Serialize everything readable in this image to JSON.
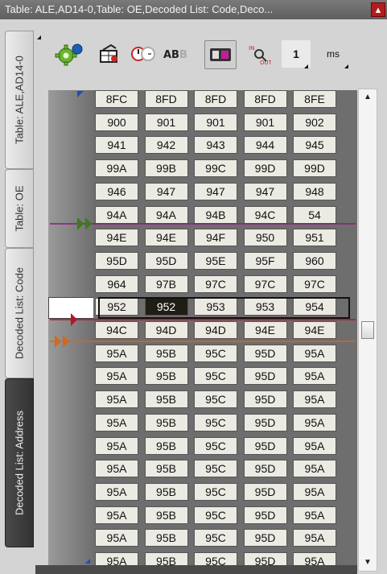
{
  "window": {
    "title": "Table: ALE,AD14-0,Table: OE,Decoded List: Code,Deco..."
  },
  "tabs": [
    {
      "label": "Table: ALE,AD14-0"
    },
    {
      "label": "Table: OE"
    },
    {
      "label": "Decoded List: Code"
    },
    {
      "label": "Decoded List: Address"
    }
  ],
  "toolbar": {
    "items": [
      {
        "name": "settings-gear-icon"
      },
      {
        "name": "clear-table-icon"
      },
      {
        "name": "time-compare-icon"
      },
      {
        "name": "ab-text-icon"
      },
      {
        "name": "toggle-display-icon"
      },
      {
        "name": "in-out-probe-icon"
      }
    ],
    "step_value": "1",
    "step_unit": "ms"
  },
  "grid": {
    "rows": [
      [
        "8FC",
        "8FD",
        "8FD",
        "8FD",
        "8FE"
      ],
      [
        "900",
        "901",
        "901",
        "901",
        "902"
      ],
      [
        "941",
        "942",
        "943",
        "944",
        "945"
      ],
      [
        "99A",
        "99B",
        "99C",
        "99D",
        "99D"
      ],
      [
        "946",
        "947",
        "947",
        "947",
        "948"
      ],
      [
        "94A",
        "94A",
        "94B",
        "94C",
        "54"
      ],
      [
        "94E",
        "94E",
        "94F",
        "950",
        "951"
      ],
      [
        "95D",
        "95D",
        "95E",
        "95F",
        "960"
      ],
      [
        "964",
        "97B",
        "97C",
        "97C",
        "97C"
      ],
      [
        "952",
        "952",
        "953",
        "953",
        "954"
      ],
      [
        "94C",
        "94D",
        "94D",
        "94E",
        "94E"
      ],
      [
        "95A",
        "95B",
        "95C",
        "95D",
        "95A"
      ],
      [
        "95A",
        "95B",
        "95C",
        "95D",
        "95A"
      ],
      [
        "95A",
        "95B",
        "95C",
        "95D",
        "95A"
      ],
      [
        "95A",
        "95B",
        "95C",
        "95D",
        "95A"
      ],
      [
        "95A",
        "95B",
        "95C",
        "95D",
        "95A"
      ],
      [
        "95A",
        "95B",
        "95C",
        "95D",
        "95A"
      ],
      [
        "95A",
        "95B",
        "95C",
        "95D",
        "95A"
      ],
      [
        "95A",
        "95B",
        "95C",
        "95D",
        "95A"
      ],
      [
        "95A",
        "95B",
        "95C",
        "95D",
        "95A"
      ],
      [
        "95A",
        "95B",
        "95C",
        "95D",
        "95A"
      ]
    ],
    "selected_row": 9,
    "selected_col": 1
  },
  "colors": {
    "marker_magenta": "#8b1c7a",
    "marker_red": "#b8122b",
    "marker_orange": "#d2691e",
    "marker_green": "#3c7a1e",
    "cell_bg": "#ecebe3",
    "selected_cell_bg": "#1e1e14"
  }
}
